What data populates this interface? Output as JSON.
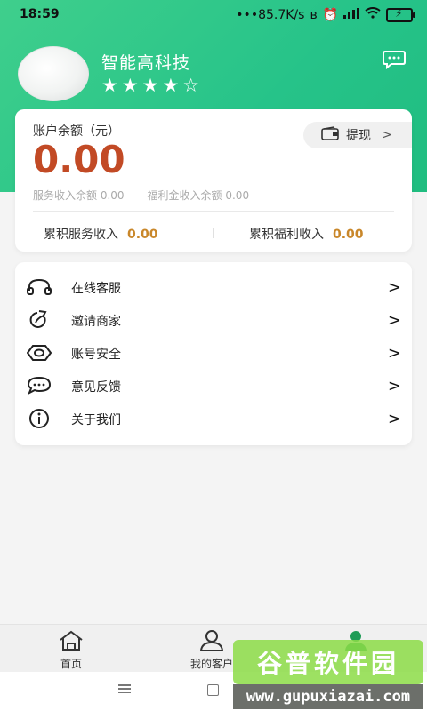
{
  "status_bar": {
    "time": "18:59",
    "network_speed": "•••85.7K/s",
    "icons": [
      "bluetooth-icon",
      "alarm-icon",
      "signal-icon",
      "wifi-icon",
      "battery-charging-icon"
    ]
  },
  "profile": {
    "company_name": "智能高科技",
    "rating": {
      "filled": 4,
      "total": 5,
      "text": "★★★★☆"
    }
  },
  "balance": {
    "label": "账户余额（元）",
    "amount": "0.00",
    "withdraw_label": "提现",
    "withdraw_chevron": ">",
    "service_income_balance": "服务收入余额 0.00",
    "welfare_income_balance": "福利金收入余额 0.00",
    "accumulated_service_label": "累积服务收入",
    "accumulated_service_value": "0.00",
    "accumulated_welfare_label": "累积福利收入",
    "accumulated_welfare_value": "0.00"
  },
  "menu": [
    {
      "label": "在线客服",
      "icon": "headset-icon",
      "arrow": ">"
    },
    {
      "label": "邀请商家",
      "icon": "share-refresh-icon",
      "arrow": ">"
    },
    {
      "label": "账号安全",
      "icon": "shield-hexagon-icon",
      "arrow": ">"
    },
    {
      "label": "意见反馈",
      "icon": "chat-bubble-icon",
      "arrow": ">"
    },
    {
      "label": "关于我们",
      "icon": "info-icon",
      "arrow": ">"
    }
  ],
  "bottom_nav": [
    {
      "label": "首页",
      "icon": "home-icon"
    },
    {
      "label": "我的客户",
      "icon": "user-icon"
    },
    {
      "label": "",
      "icon": "profile-filled-icon"
    }
  ],
  "watermark": {
    "title": "谷普软件园",
    "url": "www.gupuxiazai.com"
  },
  "colors": {
    "brand": "#26c389",
    "amount": "#c24a25",
    "accent_value": "#c9872a"
  }
}
